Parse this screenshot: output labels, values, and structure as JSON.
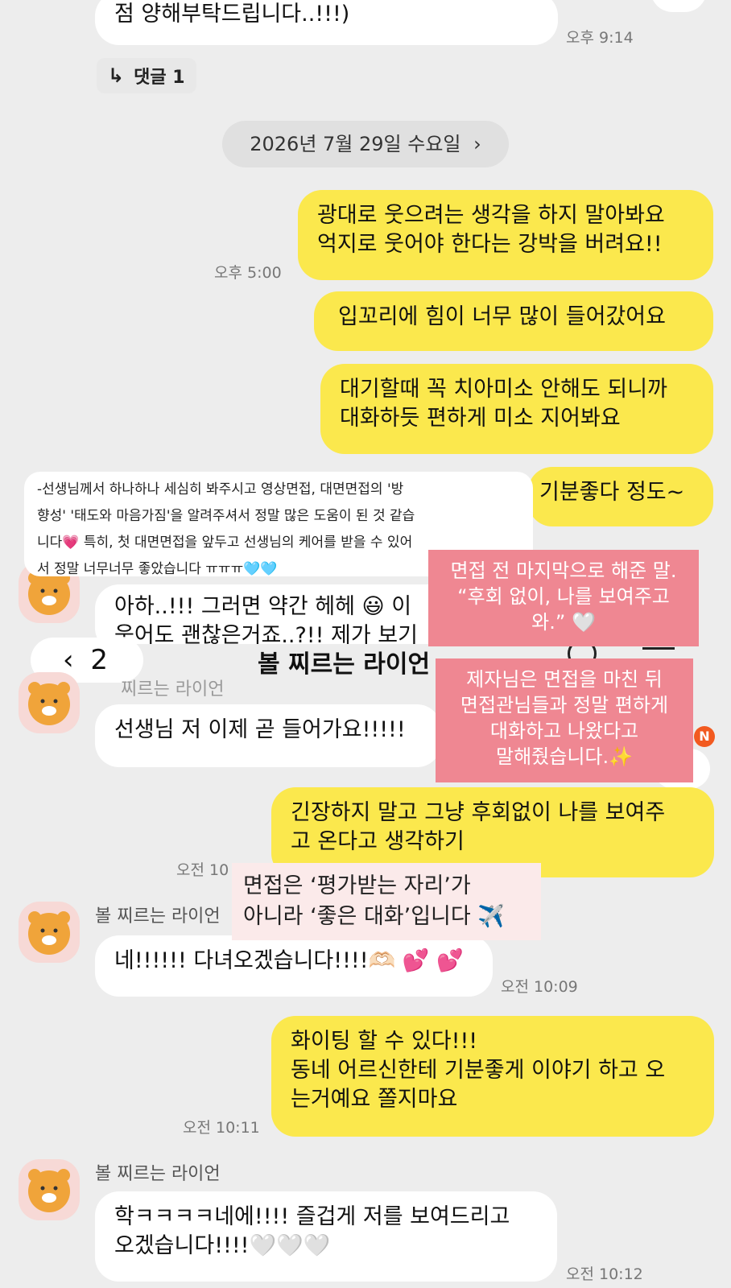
{
  "messages": {
    "m1": {
      "text": "점 양해부탁드립니다..!!!)",
      "time": "오후 9:14"
    },
    "reply": {
      "icon": "reply-arrow-icon",
      "label": "댓글 1"
    },
    "date": {
      "label": "2026년 7월 29일 수요일"
    },
    "m2": {
      "text": "광대로 웃으려는 생각을 하지 말아봐요\n억지로 웃어야 한다는 강박을 버려요!!",
      "time": "오후 5:00"
    },
    "m3": {
      "text": "입꼬리에 힘이 너무 많이 들어갔어요"
    },
    "m4": {
      "text": "대기할때 꼭 치아미소 안해도 되니까\n대화하듯 편하게 미소 지어봐요"
    },
    "m5": {
      "text": "기분좋다 정도~"
    },
    "m6": {
      "text": "아하..!!! 그러면 약간 헤헤 😃 이\n웃어도 괜찮은거죠..?!! 제가 보기"
    },
    "header": {
      "count": "2",
      "title": "볼 찌르는 라이언"
    },
    "sender_partial": "찌르는 라이언",
    "m7": {
      "text": "선생님 저 이제 곧 들어가요!!!!!"
    },
    "badge": "N",
    "m8": {
      "text": "긴장하지 말고 그냥 후회없이 나를 보여주\n고 온다고 생각하기",
      "time": "오전 10"
    },
    "sender1": "볼 찌르는 라이언",
    "m9": {
      "text": "네!!!!!! 다녀오겠습니다!!!!🫶🏻 💕 💕",
      "time": "오전 10:09"
    },
    "m10": {
      "text": "화이팅 할 수 있다!!!\n동네 어르신한테 기분좋게 이야기 하고 오\n는거예요 쫄지마요",
      "time": "오전 10:11"
    },
    "sender2": "볼 찌르는 라이언",
    "m11": {
      "text": "학ㅋㅋㅋㅋ네에!!!! 즐겁게 저를 보여드리고\n오겠습니다!!!!🤍🤍🤍",
      "time": "오전 10:12"
    }
  },
  "overlays": {
    "review": "-선생님께서 하나하나 세심히 봐주시고 영상면접, 대면면접의 '방\n향성' '태도와 마음가짐'을 알려주셔서 정말 많은 도움이 된 것 같습\n니다💗 특히, 첫 대면면접을 앞두고 선생님의 케어를 받을 수 있어\n서 정말 너무너무 좋았습니다 ㅠㅠㅠ🩵🩵",
    "pink1": "면접 전 마지막으로 해준 말.\n“후회 없이, 나를 보여주고\n와.” 🤍",
    "pink2": "제자님은 면접을 마친 뒤\n면접관님들과 정말 편하게\n대화하고 나왔다고\n말해줬습니다.✨",
    "tag": "면접은 ‘평가받는 자리’가\n아니라 ‘좋은 대화’입니다 ✈️"
  },
  "colors": {
    "my_bubble": "#fbe84d",
    "their_bubble": "#ffffff",
    "background": "#ededed",
    "pink_caption": "#ef8792"
  }
}
